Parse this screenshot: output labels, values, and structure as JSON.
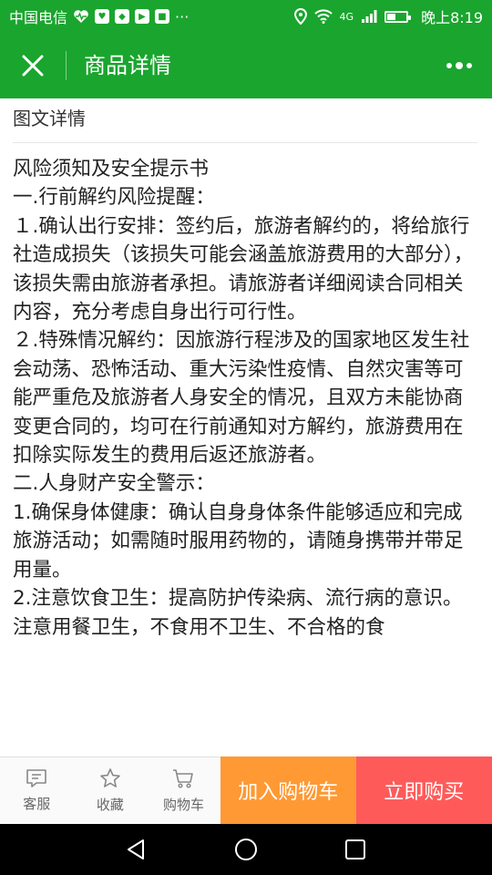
{
  "status_bar": {
    "carrier": "中国电信",
    "network": "4G",
    "time": "晚上8:19"
  },
  "header": {
    "title": "商品详情"
  },
  "content": {
    "section_title": "图文详情",
    "paragraphs": [
      "风险须知及安全提示书",
      "一.行前解约风险提醒：",
      "１.确认出行安排：签约后，旅游者解约的，将给旅行社造成损失（该损失可能会涵盖旅游费用的大部分），该损失需由旅游者承担。请旅游者详细阅读合同相关内容，充分考虑自身出行可行性。",
      "２.特殊情况解约：因旅游行程涉及的国家地区发生社会动荡、恐怖活动、重大污染性疫情、自然灾害等可能严重危及旅游者人身安全的情况，且双方未能协商变更合同的，均可在行前通知对方解约，旅游费用在扣除实际发生的费用后返还旅游者。",
      "二.人身财产安全警示：",
      "1.确保身体健康：确认自身身体条件能够适应和完成旅游活动；如需随时服用药物的，请随身携带并带足用量。",
      "2.注意饮食卫生：提高防护传染病、流行病的意识。注意用餐卫生，不食用不卫生、不合格的食"
    ]
  },
  "bottom_bar": {
    "service": "客服",
    "favorite": "收藏",
    "cart": "购物车",
    "add_to_cart": "加入购物车",
    "buy_now": "立即购买",
    "colors": {
      "brand": "#1aa52e",
      "cart_button": "#ff9933",
      "buy_button": "#ff5a5a"
    }
  }
}
